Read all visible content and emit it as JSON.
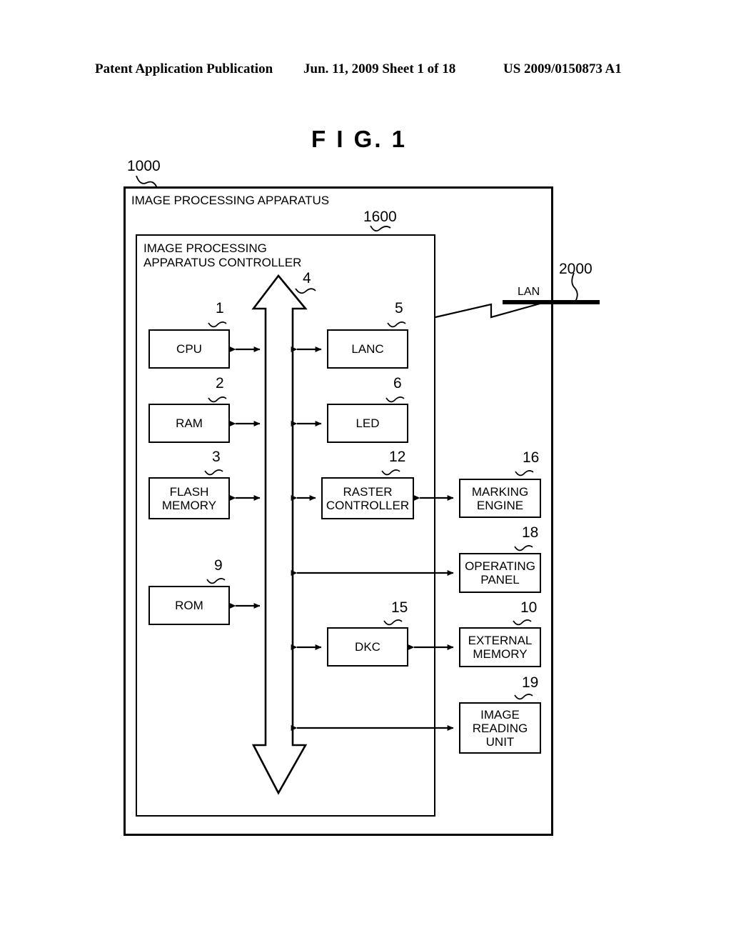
{
  "header": {
    "left": "Patent Application Publication",
    "middle": "Jun. 11, 2009  Sheet 1 of 18",
    "right": "US 2009/0150873 A1"
  },
  "figure": {
    "title": "F I G.  1",
    "outer_ref": "1000",
    "outer_label": "IMAGE PROCESSING APPARATUS",
    "inner_ref": "1600",
    "inner_label_line1": "IMAGE PROCESSING",
    "inner_label_line2": "APPARATUS CONTROLLER",
    "bus_ref": "4",
    "network": {
      "label": "LAN",
      "ref": "2000"
    }
  },
  "blocks": [
    {
      "id": "cpu",
      "ref": "1",
      "lines": [
        "CPU"
      ],
      "column": "left"
    },
    {
      "id": "ram",
      "ref": "2",
      "lines": [
        "RAM"
      ],
      "column": "left"
    },
    {
      "id": "flash-memory",
      "ref": "3",
      "lines": [
        "FLASH",
        "MEMORY"
      ],
      "column": "left"
    },
    {
      "id": "rom",
      "ref": "9",
      "lines": [
        "ROM"
      ],
      "column": "left"
    },
    {
      "id": "lanc",
      "ref": "5",
      "lines": [
        "LANC"
      ],
      "column": "middle"
    },
    {
      "id": "led",
      "ref": "6",
      "lines": [
        "LED"
      ],
      "column": "middle"
    },
    {
      "id": "raster-controller",
      "ref": "12",
      "lines": [
        "RASTER",
        "CONTROLLER"
      ],
      "column": "middle"
    },
    {
      "id": "dkc",
      "ref": "15",
      "lines": [
        "DKC"
      ],
      "column": "middle"
    },
    {
      "id": "marking-engine",
      "ref": "16",
      "lines": [
        "MARKING",
        "ENGINE"
      ],
      "column": "right"
    },
    {
      "id": "operating-panel",
      "ref": "18",
      "lines": [
        "OPERATING",
        "PANEL"
      ],
      "column": "right"
    },
    {
      "id": "external-memory",
      "ref": "10",
      "lines": [
        "EXTERNAL",
        "MEMORY"
      ],
      "column": "right"
    },
    {
      "id": "image-reading-unit",
      "ref": "19",
      "lines": [
        "IMAGE",
        "READING",
        "UNIT"
      ],
      "column": "right"
    }
  ],
  "colors": {
    "ink": "#000000",
    "paper": "#ffffff"
  }
}
